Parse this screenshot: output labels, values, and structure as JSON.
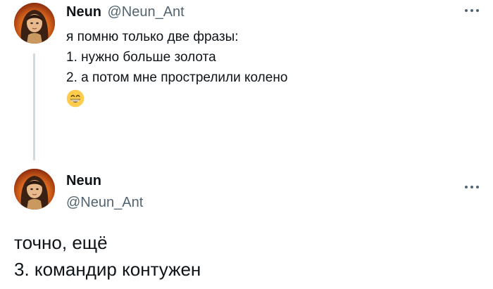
{
  "tweets": [
    {
      "author_name": "Neun",
      "author_handle": "@Neun_Ant",
      "lines": [
        "я помню только две фразы:",
        "1. нужно больше золота",
        "2. а потом мне прострелили колено"
      ],
      "emoji": "grinning-face-with-smiling-eyes"
    },
    {
      "author_name": "Neun",
      "author_handle": "@Neun_Ant",
      "lines": [
        "точно, ещё",
        "3. командир контужен"
      ]
    }
  ],
  "colors": {
    "text_primary": "#0f1419",
    "text_secondary": "#536471",
    "thread_line": "#cfd9de",
    "avatar_background": "#d47a23"
  }
}
